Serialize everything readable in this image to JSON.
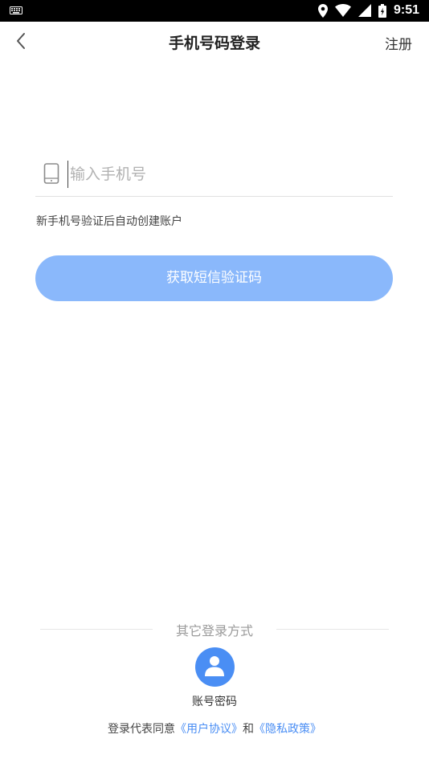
{
  "status_bar": {
    "time": "9:51",
    "icons": [
      "keyboard-icon",
      "location-icon",
      "wifi-icon",
      "signal-icon",
      "battery-icon"
    ]
  },
  "header": {
    "title": "手机号码登录",
    "register_label": "注册",
    "back_icon": "back-chevron-icon"
  },
  "login_form": {
    "phone_icon": "phone-icon",
    "phone_value": "",
    "phone_placeholder": "输入手机号",
    "hint": "新手机号验证后自动创建账户",
    "sms_button_label": "获取短信验证码"
  },
  "other_login": {
    "divider_label": "其它登录方式",
    "account_icon": "user-icon",
    "account_label": "账号密码"
  },
  "agreement": {
    "prefix": "登录代表同意",
    "user_agreement": "《用户协议》",
    "conjunction": "和",
    "privacy_policy": "《隐私政策》"
  },
  "colors": {
    "accent": "#4a8ef4",
    "button_disabled": "#8ab8fb",
    "status_bar": "#000000"
  }
}
